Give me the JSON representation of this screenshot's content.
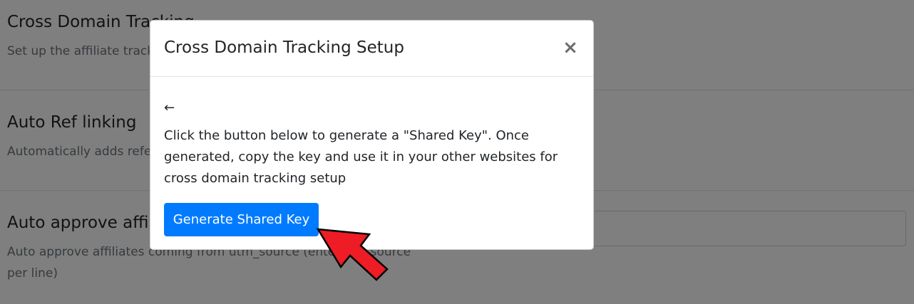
{
  "background": {
    "sections": [
      {
        "title": "Cross Domain Tracking",
        "description": "Set up the affiliate tracking"
      },
      {
        "title": "Auto Ref linking",
        "description": "Automatically adds referral"
      },
      {
        "title": "Auto approve affiliates",
        "description_line1": "Auto approve affiliates coming from utm_source (enter one source",
        "description_line2": "per line)"
      }
    ]
  },
  "modal": {
    "title": "Cross Domain Tracking Setup",
    "close_glyph": "×",
    "back_glyph": "←",
    "body_text": "Click the button below to generate a \"Shared Key\". Once generated, copy the key and use it in your other websites for cross domain tracking setup",
    "button_label": "Generate Shared Key"
  },
  "colors": {
    "primary": "#007bff",
    "annotation_arrow": "#ee1c24"
  }
}
